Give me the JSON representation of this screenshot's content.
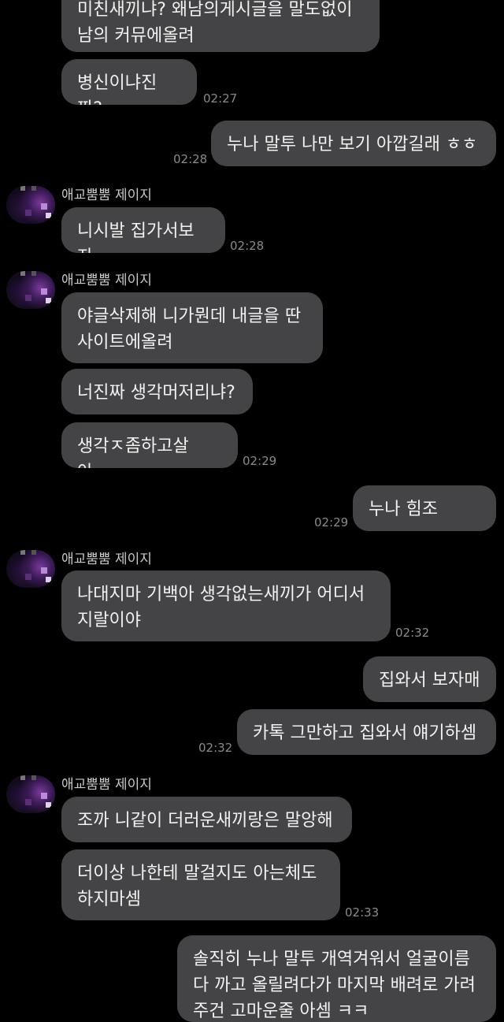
{
  "sender_name": "애교뿜뿜 제이지",
  "messages": [
    {
      "text": "미친새끼냐? 왜남의게시글을 말도없이 남의 커뮤에올려",
      "time": ""
    },
    {
      "text": "병신이냐진짜?",
      "time": "02:27"
    },
    {
      "text": "누나 말투 나만 보기 아깝길래 ㅎㅎ",
      "time": "02:28"
    },
    {
      "text": "니시발 집가서보자",
      "time": "02:28"
    },
    {
      "text": "야글삭제해 니가뭔데 내글을 딴 사이트에올려",
      "time": ""
    },
    {
      "text": "너진짜 생각머저리냐?",
      "time": ""
    },
    {
      "text": "생각ㅈ좀하고살아;;;",
      "time": "02:29"
    },
    {
      "text": "누나 힘조~~~~",
      "time": "02:29"
    },
    {
      "text": "나대지마 기백아 생각없는새끼가 어디서 지랄이야",
      "time": "02:32"
    },
    {
      "text": "집와서 보자매",
      "time": ""
    },
    {
      "text": "카톡 그만하고 집와서 얘기하셈",
      "time": "02:32"
    },
    {
      "text": "조까 니같이 더러운새끼랑은 말앙해",
      "time": ""
    },
    {
      "text": "더이상 나한테 말걸지도 아는체도 하지마셈",
      "time": "02:33"
    },
    {
      "text": "솔직히 누나 말투 개역겨워서 얼굴이름 다 까고 올릴려다가 마지막 배려로 가려주건 고마운줄 아셈 ㅋㅋ",
      "time": ""
    }
  ]
}
